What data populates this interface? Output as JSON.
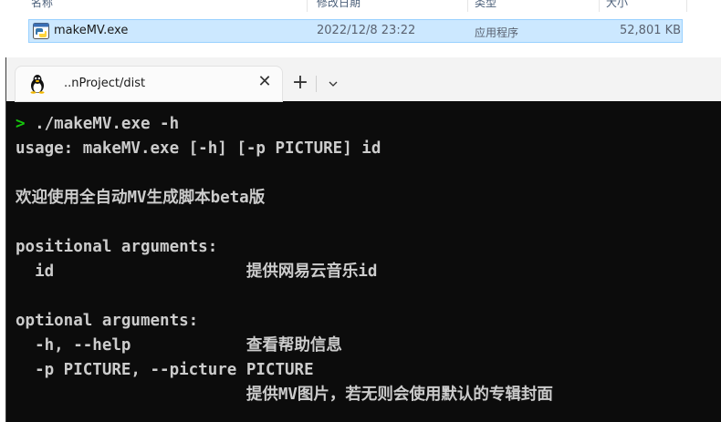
{
  "explorer": {
    "columns": [
      "名称",
      "修改日期",
      "类型",
      "大小"
    ],
    "file": {
      "name": "makeMV.exe",
      "modified": "2022/12/8 23:22",
      "type": "应用程序",
      "size": "52,801 KB"
    }
  },
  "terminal": {
    "tab_title": "..nProject/dist",
    "close_icon_glyph": "✕",
    "newtab_glyph": "+",
    "prompt_symbol": ">",
    "command": " ./makeMV.exe -h",
    "output": [
      "usage: makeMV.exe [-h] [-p PICTURE] id",
      "",
      "欢迎使用全自动MV生成脚本beta版",
      "",
      "positional arguments:",
      "  id                    提供网易云音乐id",
      "",
      "optional arguments:",
      "  -h, --help            查看帮助信息",
      "  -p PICTURE, --picture PICTURE",
      "                        提供MV图片，若无则会使用默认的专辑封面"
    ],
    "colors": {
      "background": "#0c0c0c",
      "foreground": "#cccccc",
      "prompt": "#16c60c",
      "tabbar": "#f3f3f3"
    }
  }
}
